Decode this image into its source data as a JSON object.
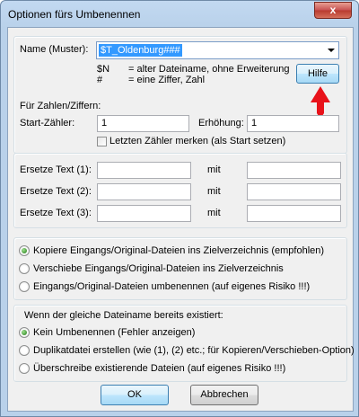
{
  "window": {
    "title": "Optionen fürs Umbenennen",
    "close_label": "x"
  },
  "name": {
    "label": "Name (Muster):",
    "value": "$T_Oldenburg###",
    "hint_n_key": "$N",
    "hint_n_text": "= alter Dateiname, ohne Erweiterung",
    "hint_hash_key": "#",
    "hint_hash_text": "= eine Ziffer, Zahl",
    "help_button": "Hilfe"
  },
  "numbers": {
    "heading": "Für Zahlen/Ziffern:",
    "start_label": "Start-Zähler:",
    "start_value": "1",
    "increment_label": "Erhöhung:",
    "increment_value": "1",
    "remember_label": "Letzten Zähler merken (als Start setzen)",
    "remember_checked": false
  },
  "replace": {
    "rows": [
      {
        "label": "Ersetze Text (1):",
        "with": "mit"
      },
      {
        "label": "Ersetze Text (2):",
        "with": "mit"
      },
      {
        "label": "Ersetze Text (3):",
        "with": "mit"
      }
    ]
  },
  "mode": {
    "options": [
      "Kopiere Eingangs/Original-Dateien ins Zielverzeichnis (empfohlen)",
      "Verschiebe Eingangs/Original-Dateien ins Zielverzeichnis",
      "Eingangs/Original-Dateien umbenennen (auf eigenes Risiko !!!)"
    ],
    "selected": 0
  },
  "exists": {
    "heading": "Wenn der gleiche Dateiname bereits existiert:",
    "options": [
      "Kein Umbenennen (Fehler anzeigen)",
      "Duplikatdatei erstellen (wie (1), (2) etc.; für Kopieren/Verschieben-Option)",
      "Überschreibe existierende Dateien (auf eigenes Risiko !!!)"
    ],
    "selected": 0
  },
  "buttons": {
    "ok": "OK",
    "cancel": "Abbrechen"
  },
  "colors": {
    "annotation_arrow": "#e8121a",
    "selection": "#3399ff"
  }
}
